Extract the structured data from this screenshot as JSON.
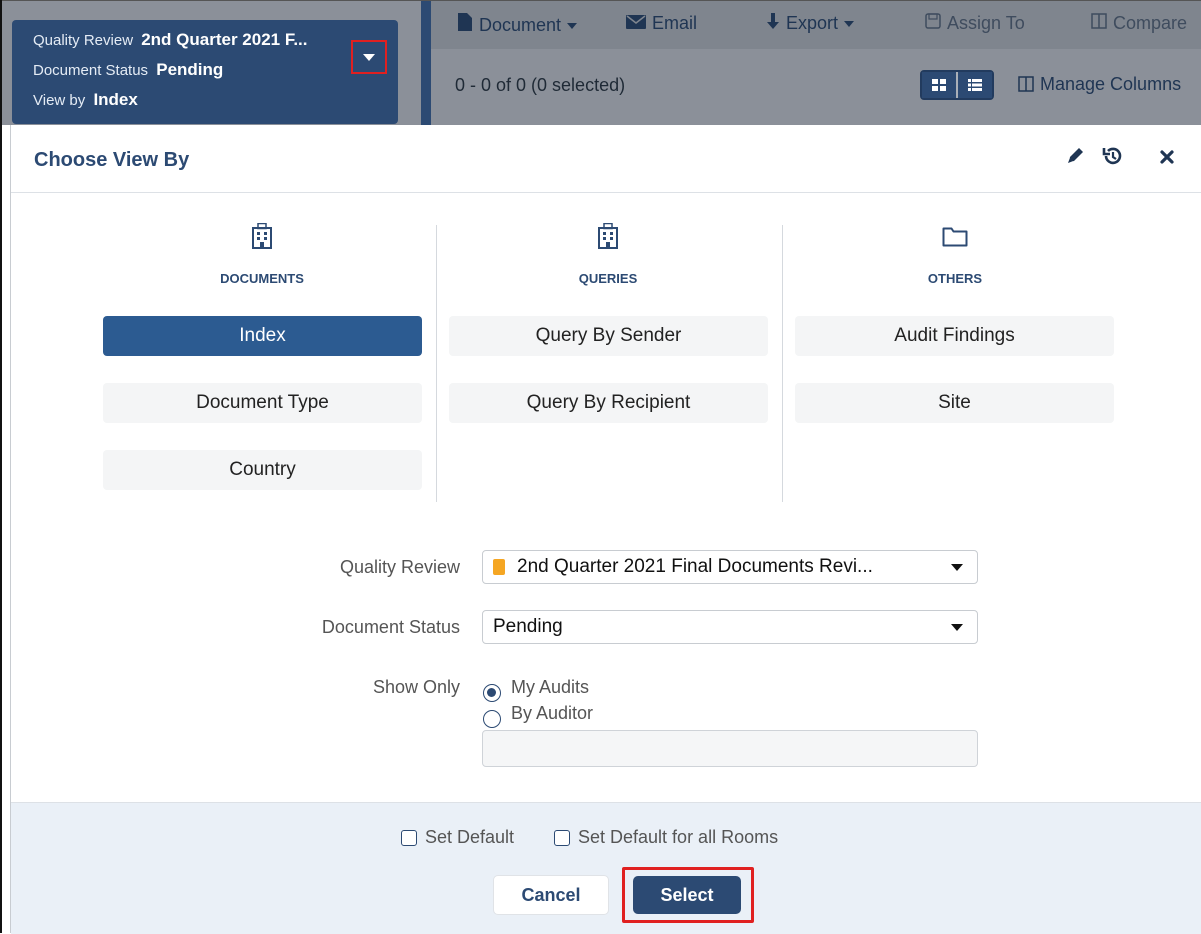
{
  "context_panel": {
    "quality_review_label": "Quality Review",
    "quality_review_value": "2nd Quarter 2021 F...",
    "document_status_label": "Document Status",
    "document_status_value": "Pending",
    "view_by_label": "View by",
    "view_by_value": "Index"
  },
  "toolbar": {
    "document": "Document",
    "email": "Email",
    "export": "Export",
    "assign_to": "Assign To",
    "compare": "Compare"
  },
  "results": {
    "count_text": "0 - 0 of 0 (0 selected)",
    "manage_columns": "Manage Columns"
  },
  "dialog": {
    "title": "Choose View By",
    "categories": [
      {
        "label": "DOCUMENTS",
        "icon": "building-icon",
        "options": [
          "Index",
          "Document Type",
          "Country"
        ]
      },
      {
        "label": "QUERIES",
        "icon": "building-icon",
        "options": [
          "Query By Sender",
          "Query By Recipient"
        ]
      },
      {
        "label": "OTHERS",
        "icon": "folder-icon",
        "options": [
          "Audit Findings",
          "Site"
        ]
      }
    ],
    "selected_option": "Index",
    "form": {
      "quality_review_label": "Quality Review",
      "quality_review_value": "2nd Quarter 2021 Final Documents Revi...",
      "document_status_label": "Document Status",
      "document_status_value": "Pending",
      "show_only_label": "Show Only",
      "radio_my_audits": "My Audits",
      "radio_by_auditor": "By Auditor",
      "selected_radio": "My Audits"
    },
    "footer": {
      "set_default": "Set Default",
      "set_default_all_rooms": "Set Default for all Rooms",
      "cancel": "Cancel",
      "select": "Select"
    }
  },
  "colors": {
    "primary": "#2c4a73",
    "active_option": "#2c5b91",
    "highlight_border": "#e02020",
    "footer_bg": "#eaf0f7"
  }
}
